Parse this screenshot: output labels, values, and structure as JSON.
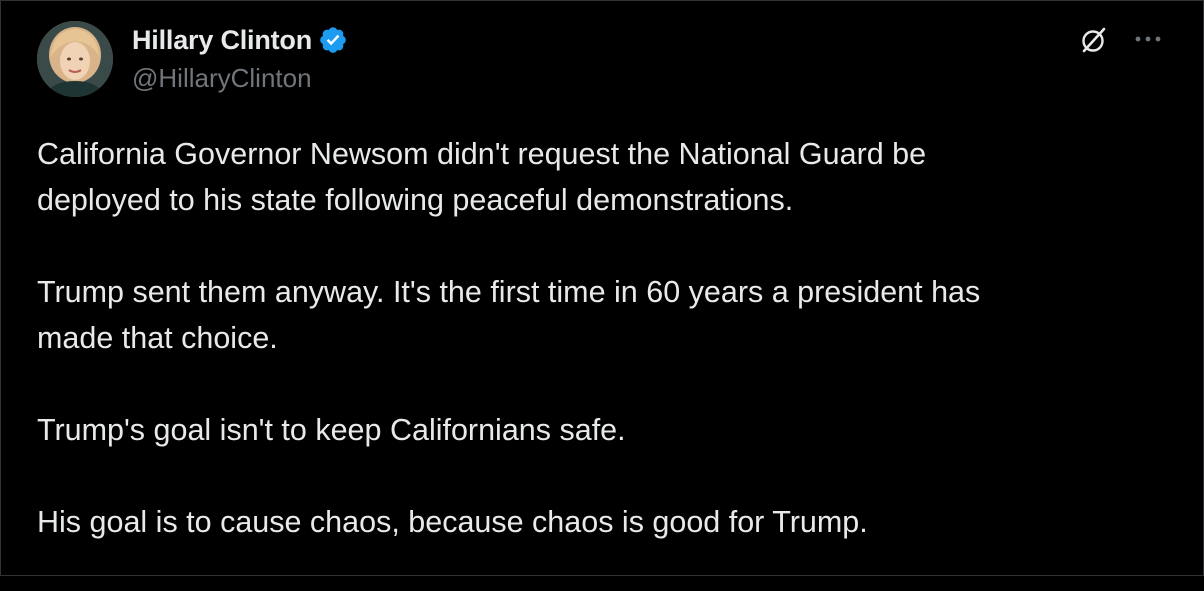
{
  "author": {
    "display_name": "Hillary Clinton",
    "handle": "@HillaryClinton",
    "verified": true,
    "verified_color": "#1d9bf0"
  },
  "icons": {
    "avatar": "profile-photo",
    "verified": "verified-badge-icon",
    "grok": "grok-icon",
    "more": "more-options-icon"
  },
  "tweet": {
    "paragraphs": [
      "California Governor Newsom didn't request the National Guard be\ndeployed to his state following peaceful demonstrations.",
      "Trump sent them anyway. It's the first time in 60 years a president has\nmade that choice.",
      "Trump's goal isn't to keep Californians safe.",
      "His goal is to cause chaos, because chaos is good for Trump."
    ]
  },
  "colors": {
    "background": "#000000",
    "text_primary": "#e7e9ea",
    "text_secondary": "#71767b",
    "border": "#2f3336"
  }
}
